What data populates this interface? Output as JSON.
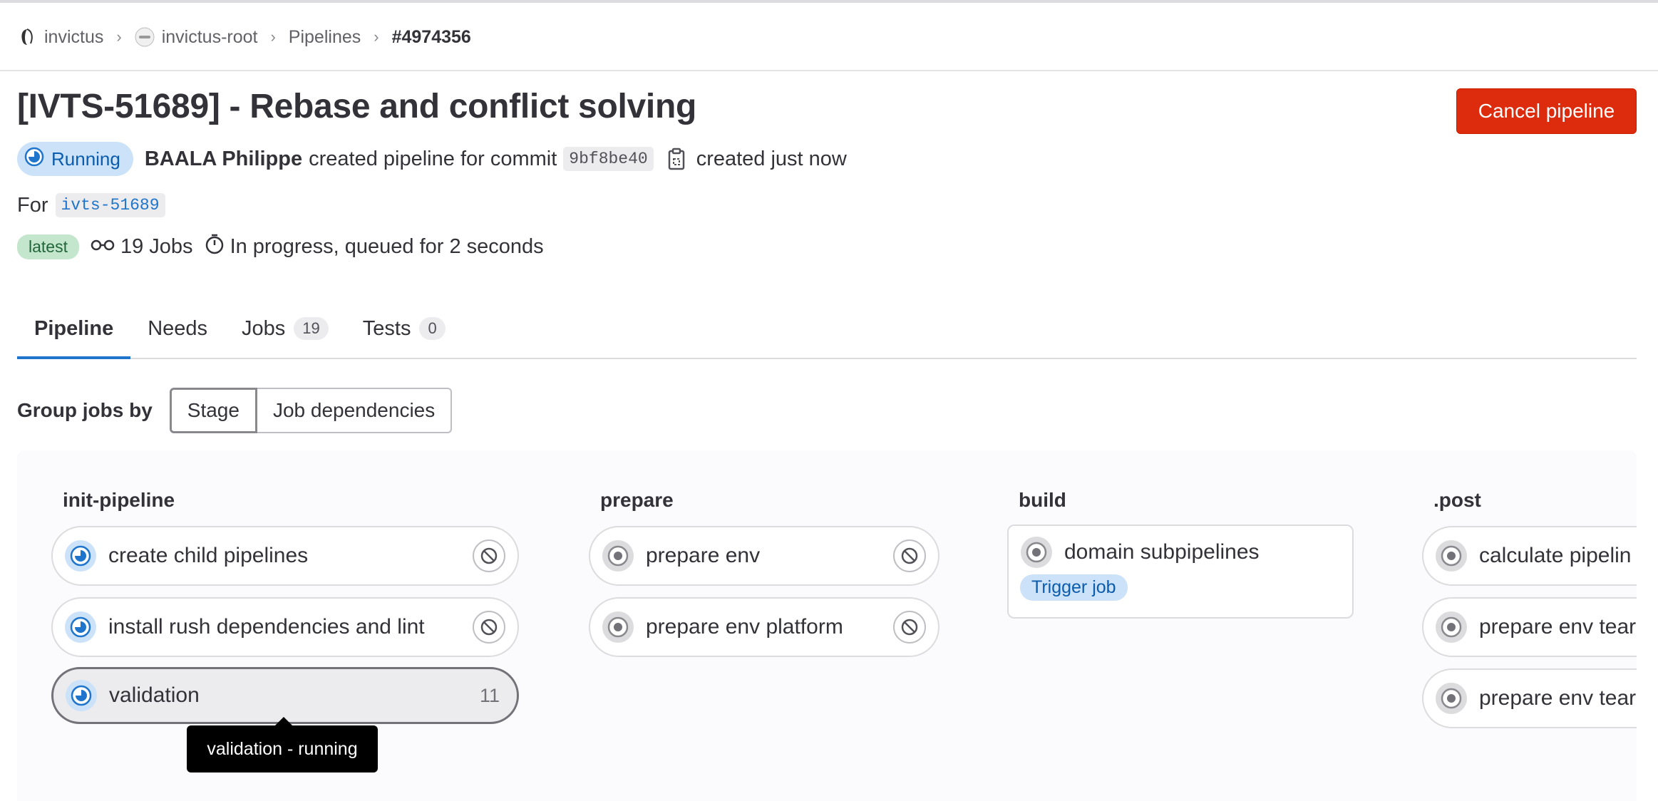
{
  "breadcrumb": {
    "items": [
      {
        "label": "invictus",
        "icon": "project-avatar-icon"
      },
      {
        "label": "invictus-root",
        "icon": "group-avatar-icon"
      },
      {
        "label": "Pipelines"
      },
      {
        "label": "#4974356"
      }
    ]
  },
  "header": {
    "title": "[IVTS-51689] - Rebase and conflict solving",
    "cancel_label": "Cancel pipeline",
    "status": "Running",
    "author": "BAALA Philippe",
    "created_text": "created pipeline for commit",
    "commit_sha": "9bf8be40",
    "created_time": "created just now",
    "for_label": "For",
    "ref": "ivts-51689",
    "latest_badge": "latest",
    "jobs_text": "19 Jobs",
    "duration_text": "In progress, queued for 2 seconds"
  },
  "tabs": [
    {
      "label": "Pipeline"
    },
    {
      "label": "Needs"
    },
    {
      "label": "Jobs",
      "count": "19"
    },
    {
      "label": "Tests",
      "count": "0"
    }
  ],
  "group_by": {
    "label": "Group jobs by",
    "options": [
      "Stage",
      "Job dependencies"
    ],
    "selected": "Stage"
  },
  "stages": [
    {
      "name": "init-pipeline",
      "jobs": [
        {
          "name": "create child pipelines",
          "status": "running"
        },
        {
          "name": "install rush dependencies and lint",
          "status": "running"
        },
        {
          "name": "validation",
          "status": "running",
          "count": "11"
        }
      ]
    },
    {
      "name": "prepare",
      "jobs": [
        {
          "name": "prepare env",
          "status": "created"
        },
        {
          "name": "prepare env platform",
          "status": "created"
        }
      ]
    },
    {
      "name": "build",
      "jobs": [
        {
          "name": "domain subpipelines",
          "status": "created",
          "badge": "Trigger job"
        }
      ]
    },
    {
      "name": ".post",
      "jobs": [
        {
          "name": "calculate pipelin",
          "status": "created"
        },
        {
          "name": "prepare env tear",
          "status": "created"
        },
        {
          "name": "prepare env tear",
          "status": "created"
        }
      ]
    }
  ],
  "tooltip": "validation - running",
  "colors": {
    "cancel": "#dd2b0e",
    "running": "#1f75cb",
    "running_bg": "#cbe2f9",
    "latest_bg": "#c3e6cd",
    "tab_active": "#1f75cb"
  }
}
